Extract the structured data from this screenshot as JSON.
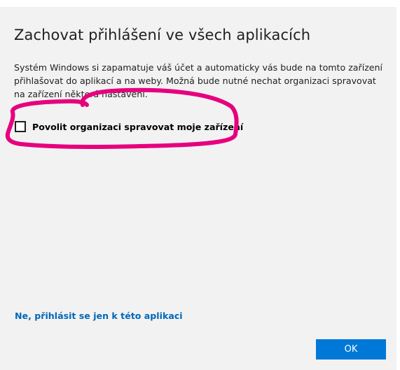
{
  "dialog": {
    "title": "Zachovat přihlášení ve všech aplikacích",
    "description": "Systém Windows si zapamatuje váš účet a automaticky vás bude na tomto zařízení přihlašovat do aplikací a na weby. Možná bude nutné nechat organizaci spravovat na zařízení některá nastavení.",
    "checkbox": {
      "label": "Povolit organizaci spravovat moje zařízení",
      "checked": false
    },
    "link_label": "Ne, přihlásit se jen k této aplikaci",
    "ok_label": "OK"
  },
  "colors": {
    "background": "#f2f2f2",
    "accent": "#0078d7",
    "link": "#0067b8",
    "annotation": "#e6007e"
  }
}
